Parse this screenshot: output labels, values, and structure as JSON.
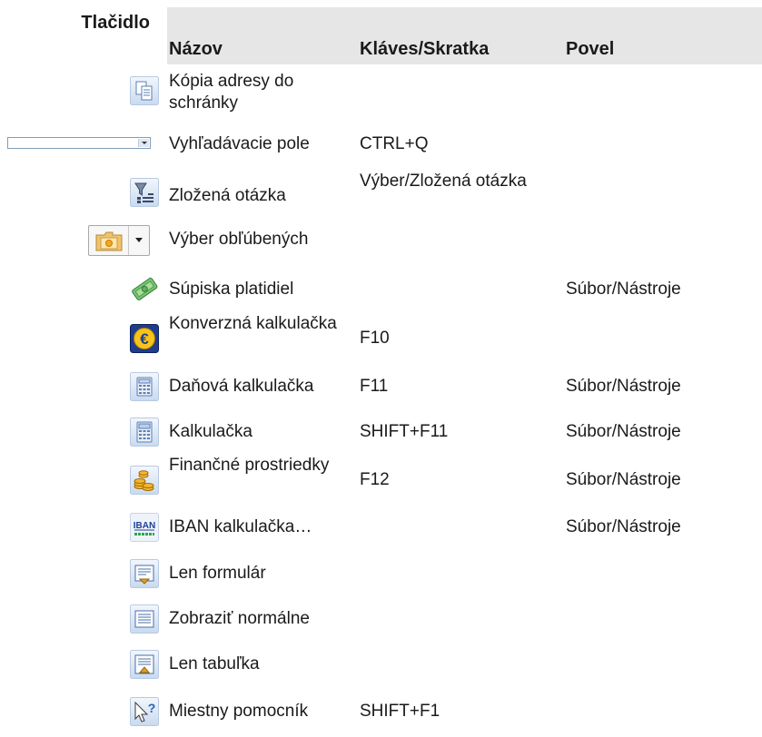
{
  "header": {
    "button_col": "Tlačidlo",
    "name_col": "Názov",
    "key_col": "Kláves/Skratka",
    "command_col": "Povel"
  },
  "rows": [
    {
      "icon": "copy-address-icon",
      "name": "Kópia adresy do schránky",
      "key": "",
      "command": ""
    },
    {
      "icon": "search-combo-box",
      "name": "Vyhľadávacie pole",
      "key": "CTRL+Q",
      "command": ""
    },
    {
      "icon": "compound-query-icon",
      "name": "Zložená otázka",
      "key": "Výber/Zložená otázka",
      "command": ""
    },
    {
      "icon": "favorites-dropdown-icon",
      "name": "Výber obľúbených",
      "key": "",
      "command": ""
    },
    {
      "icon": "money-icon",
      "name": "Súpiska platidiel",
      "key": "",
      "command": "Súbor/Nástroje"
    },
    {
      "icon": "euro-icon",
      "name": "Konverzná kalkulačka",
      "key": "F10",
      "command": ""
    },
    {
      "icon": "tax-calculator-icon",
      "name": "Daňová kalkulačka",
      "key": "F11",
      "command": "Súbor/Nástroje"
    },
    {
      "icon": "calculator-icon",
      "name": "Kalkulačka",
      "key": "SHIFT+F11",
      "command": "Súbor/Nástroje"
    },
    {
      "icon": "coins-icon",
      "name": "Finančné prostriedky",
      "key": "F12",
      "command": "Súbor/Nástroje"
    },
    {
      "icon": "iban-icon",
      "name": "IBAN kalkulačka…",
      "key": "",
      "command": "Súbor/Nástroje"
    },
    {
      "icon": "form-only-icon",
      "name": "Len formulár",
      "key": "",
      "command": ""
    },
    {
      "icon": "normal-view-icon",
      "name": "Zobraziť normálne",
      "key": "",
      "command": ""
    },
    {
      "icon": "table-only-icon",
      "name": "Len tabuľka",
      "key": "",
      "command": ""
    },
    {
      "icon": "help-pointer-icon",
      "name": "Miestny pomocník",
      "key": "SHIFT+F1",
      "command": ""
    }
  ]
}
